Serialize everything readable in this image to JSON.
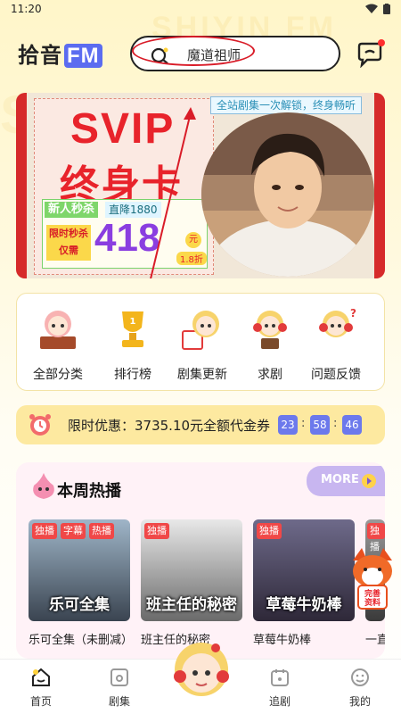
{
  "status": {
    "time": "11:20"
  },
  "header": {
    "logo_text": "拾音",
    "logo_fm": "FM",
    "search_text": "魔道祖师"
  },
  "banner": {
    "title_top": "SVIP",
    "title_bottom": "终身卡",
    "tag": "全站剧集一次解锁，终身畅听",
    "new_user_label": "新人秒杀",
    "drop_label": "直降1880",
    "limit_label": "限时秒杀仅需",
    "price": "418",
    "currency": "元",
    "discount": "1.8折"
  },
  "categories": [
    {
      "label": "全部分类"
    },
    {
      "label": "排行榜"
    },
    {
      "label": "剧集更新"
    },
    {
      "label": "求剧"
    },
    {
      "label": "问题反馈"
    }
  ],
  "promo_bar": {
    "text": "限时优惠：3735.10元全额代金券",
    "hours": "23",
    "minutes": "58",
    "seconds": "46"
  },
  "weekly": {
    "title": "本周热播",
    "more_label": "MORE",
    "cards": [
      {
        "title": "乐可全集（未删减）",
        "cover_text": "乐可全集",
        "tags": [
          "独播",
          "字幕",
          "热播"
        ]
      },
      {
        "title": "班主任的秘密",
        "cover_text": "班主任的秘密",
        "tags": [
          "独播"
        ]
      },
      {
        "title": "草莓牛奶棒",
        "cover_text": "草莓牛奶棒",
        "tags": [
          "独播"
        ]
      },
      {
        "title": "一直",
        "cover_text": "",
        "tags": [
          "独播"
        ]
      }
    ],
    "fox_label": "完善资料"
  },
  "tabbar": {
    "items": [
      {
        "label": "首页"
      },
      {
        "label": "剧集"
      },
      {
        "label": "追剧"
      },
      {
        "label": "我的"
      }
    ]
  },
  "colors": {
    "accent_red": "#e8232b",
    "accent_purple": "#6c79ec",
    "banner_bg": "#f1e7d8"
  }
}
